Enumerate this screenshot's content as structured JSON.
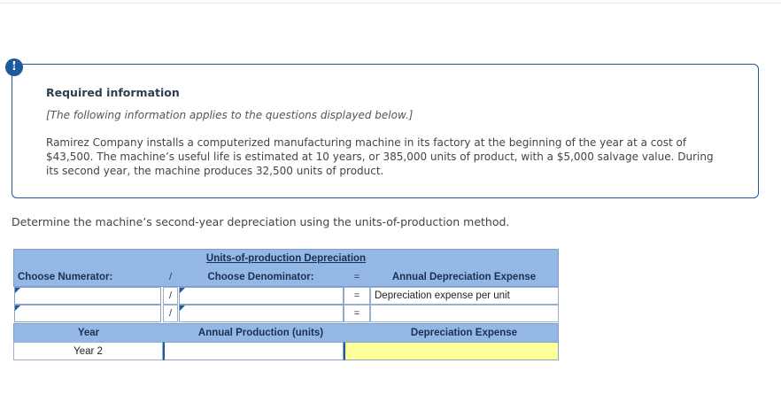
{
  "alert": {
    "icon_symbol": "!"
  },
  "info": {
    "title": "Required information",
    "applies": "[The following information applies to the questions displayed below.]",
    "body": "Ramirez Company installs a computerized manufacturing machine in its factory at the beginning of the year at a cost of $43,500. The machine’s useful life is estimated at 10 years, or 385,000 units of product, with a $5,000 salvage value. During its second year, the machine produces 32,500 units of product."
  },
  "question": "Determine the machine’s second-year depreciation using the units-of-production method.",
  "table": {
    "title": "Units-of-production Depreciation",
    "numerator_header": "Choose Numerator:",
    "divide_symbol": "/",
    "denominator_header": "Choose Denominator:",
    "equals_symbol": "=",
    "result_header": "Annual Depreciation Expense",
    "row1_result": "Depreciation expense per unit",
    "row2_result": "",
    "year_header": "Year",
    "production_header": "Annual Production (units)",
    "expense_header": "Depreciation Expense",
    "year_value": "Year 2"
  }
}
